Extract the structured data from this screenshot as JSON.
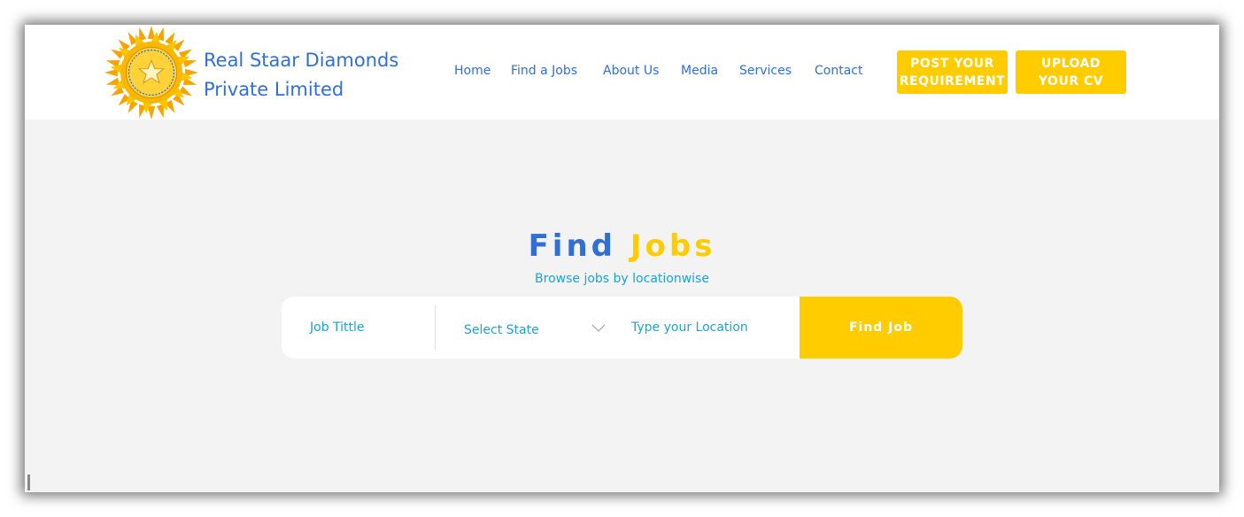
{
  "header": {
    "brand_line1": "Real Staar Diamonds",
    "brand_line2": "Private Limited",
    "logo_icon": "sun-star-logo",
    "nav": [
      {
        "label": "Home"
      },
      {
        "label": "Find a Jobs"
      },
      {
        "label": "About Us"
      },
      {
        "label": "Media"
      },
      {
        "label": "Services"
      },
      {
        "label": "Contact"
      }
    ],
    "post_button_line1": "POST YOUR",
    "post_button_line2": "REQUIREMENT",
    "upload_button_line1": "UPLOAD",
    "upload_button_line2": "YOUR CV"
  },
  "hero": {
    "title_part1": "Find",
    "title_part2": "Jobs",
    "subtitle": "Browse jobs by locationwise"
  },
  "search": {
    "job_title_placeholder": "Job Tittle",
    "state_select": "Select State",
    "location_placeholder": "Type your Location",
    "button_label": "Find Job"
  },
  "colors": {
    "brand_blue": "#2f6fd6",
    "accent_yellow": "#ffcc00",
    "light_blue": "#1aa3d8",
    "page_bg": "#f3f3f3"
  }
}
